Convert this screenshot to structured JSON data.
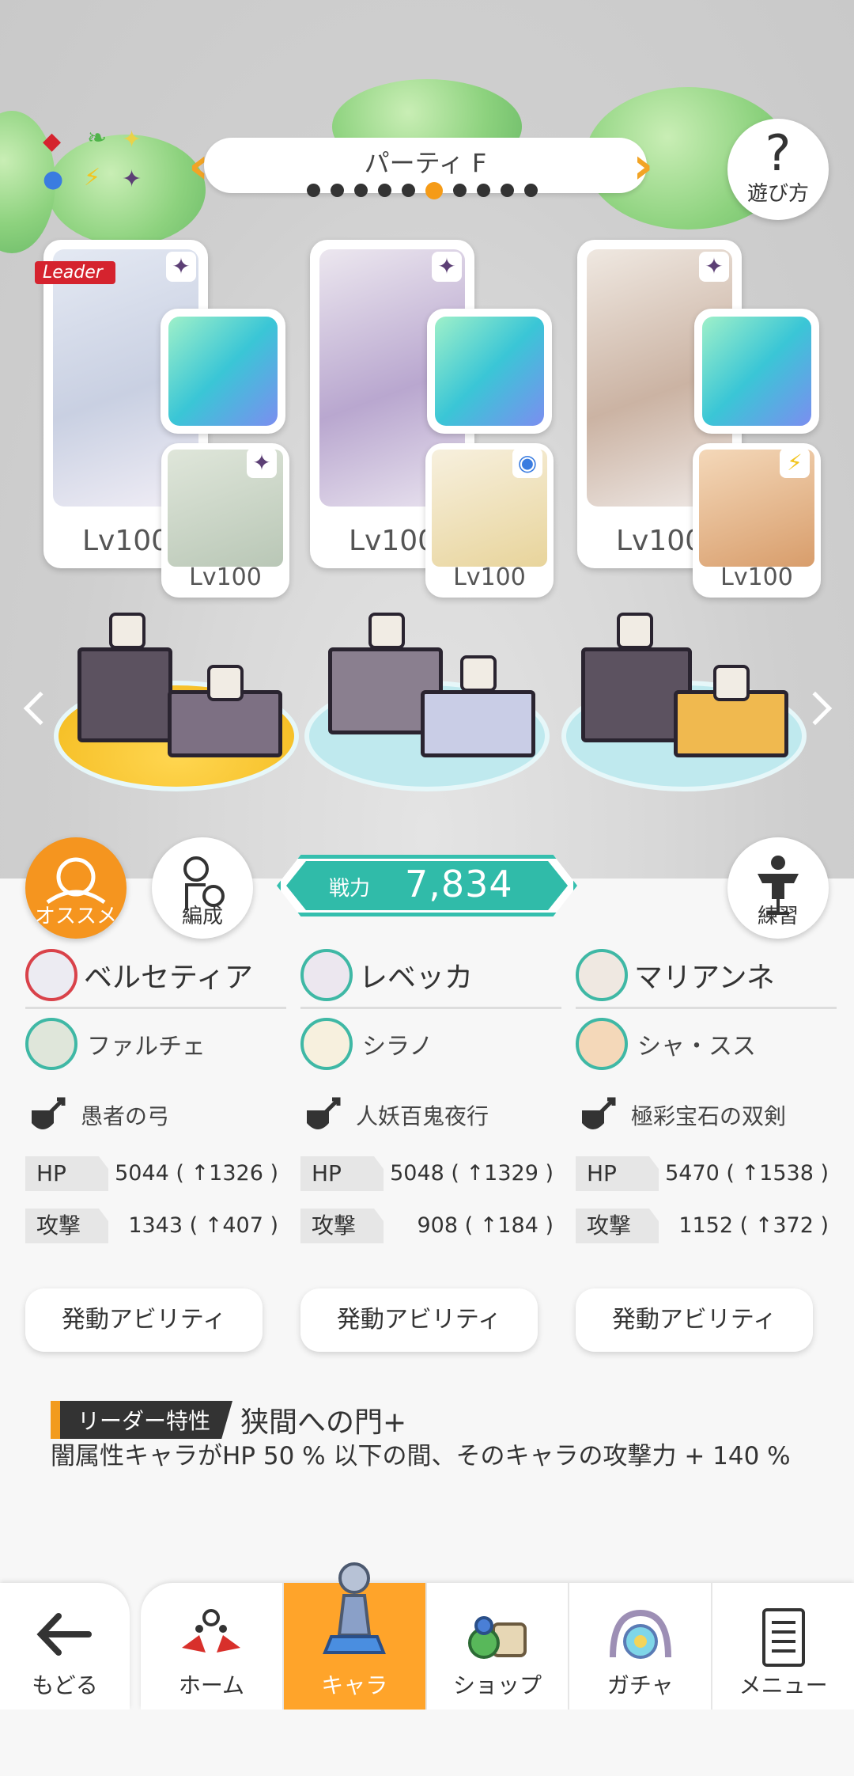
{
  "party": {
    "title": "パーティ F",
    "total": 10,
    "active_index": 5
  },
  "help": {
    "label": "遊び方"
  },
  "leader_tag": "Leader",
  "members": [
    {
      "main_name": "ベルセティア",
      "main_lv": "Lv100",
      "sub_name": "ファルチェ",
      "sub_lv": "Lv100",
      "weapon": "愚者の弓",
      "hp_label": "HP",
      "hp": "5044 ( ↑1326 )",
      "atk_label": "攻撃",
      "atk": "1343 ( ↑407 )",
      "ability": "発動アビリティ"
    },
    {
      "main_name": "レベッカ",
      "main_lv": "Lv100",
      "sub_name": "シラノ",
      "sub_lv": "Lv100",
      "weapon": "人妖百鬼夜行",
      "hp_label": "HP",
      "hp": "5048 ( ↑1329 )",
      "atk_label": "攻撃",
      "atk": "908 ( ↑184 )",
      "ability": "発動アビリティ"
    },
    {
      "main_name": "マリアンネ",
      "main_lv": "Lv100",
      "sub_name": "シャ・スス",
      "sub_lv": "Lv100",
      "weapon": "極彩宝石の双剣",
      "hp_label": "HP",
      "hp": "5470 ( ↑1538 )",
      "atk_label": "攻撃",
      "atk": "1152 ( ↑372 )",
      "ability": "発動アビリティ"
    }
  ],
  "buttons": {
    "recommend": "オススメ",
    "formation": "編成",
    "practice": "練習"
  },
  "power": {
    "label": "戦力",
    "value": "7,834"
  },
  "leader_trait": {
    "tag": "リーダー特性",
    "name": "狭間への門+",
    "desc": "闇属性キャラがHP 50 % 以下の間、そのキャラの攻撃力 + 140 %"
  },
  "nav": {
    "back": "もどる",
    "tabs": [
      "ホーム",
      "キャラ",
      "ショップ",
      "ガチャ",
      "メニュー"
    ],
    "active": "キャラ"
  },
  "colors": {
    "accent": "#f59b17",
    "power": "#30bba9",
    "leader": "#d5232e"
  }
}
